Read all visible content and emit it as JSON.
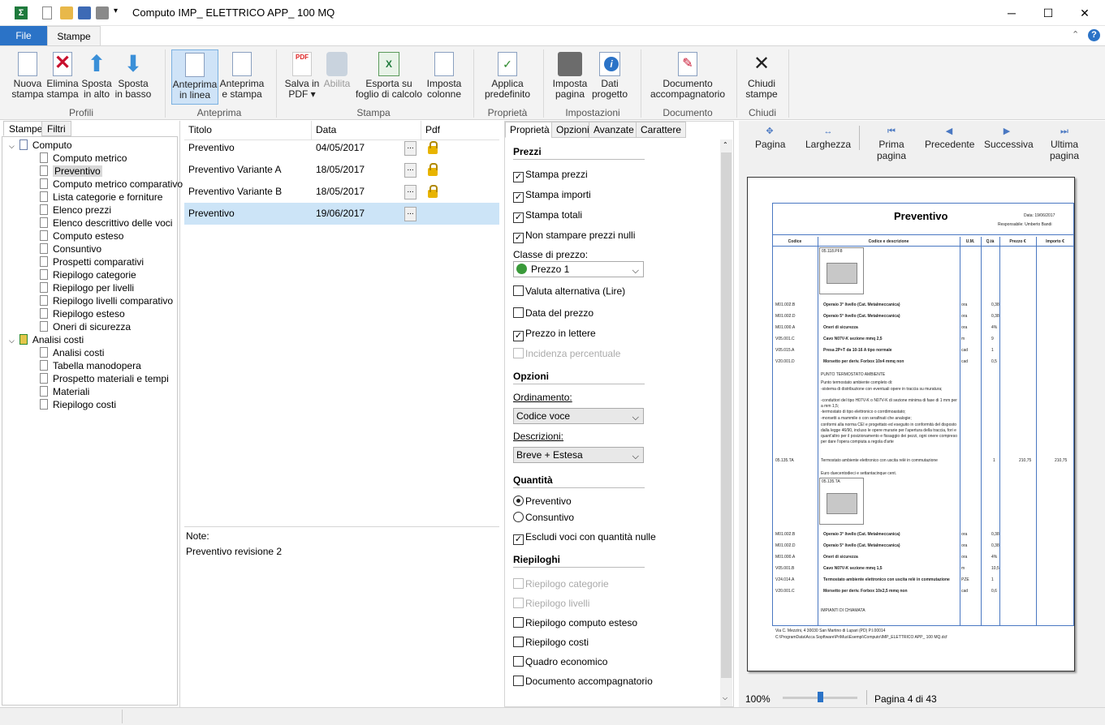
{
  "window": {
    "title": "Computo IMP_ ELETTRICO APP_ 100 MQ",
    "minimize": "─",
    "maximize": "☐",
    "close": "✕"
  },
  "ribbon_tabs": {
    "file": "File",
    "stampe": "Stampe"
  },
  "ribbon": {
    "buttons": [
      {
        "label1": "Nuova",
        "label2": "stampa"
      },
      {
        "label1": "Elimina",
        "label2": "stampa"
      },
      {
        "label1": "Sposta",
        "label2": "in alto"
      },
      {
        "label1": "Sposta",
        "label2": "in basso"
      },
      {
        "label1": "Anteprima",
        "label2": "in linea"
      },
      {
        "label1": "Anteprima",
        "label2": "e stampa"
      },
      {
        "label1": "Salva in",
        "label2": "PDF ▾"
      },
      {
        "label1": "Abilita",
        "label2": ""
      },
      {
        "label1": "Esporta su",
        "label2": "foglio di calcolo"
      },
      {
        "label1": "Imposta",
        "label2": "colonne"
      },
      {
        "label1": "Applica",
        "label2": "predefinito"
      },
      {
        "label1": "Imposta",
        "label2": "pagina"
      },
      {
        "label1": "Dati",
        "label2": "progetto"
      },
      {
        "label1": "Documento",
        "label2": "accompagnatorio"
      },
      {
        "label1": "Chiudi",
        "label2": "stampe"
      }
    ],
    "groups": [
      "Profili",
      "Anteprima",
      "Stampa",
      "Proprietà",
      "Impostazioni",
      "Documento",
      "Chiudi"
    ]
  },
  "left_tabs": [
    "Stampe",
    "Filtri"
  ],
  "tree": {
    "root1": "Computo",
    "items1": [
      "Computo metrico",
      "Preventivo",
      "Computo metrico comparativo",
      "Lista categorie e forniture",
      "Elenco prezzi",
      "Elenco descrittivo delle voci",
      "Computo esteso",
      "Consuntivo",
      "Prospetti comparativi",
      "Riepilogo categorie",
      "Riepilogo per livelli",
      "Riepilogo livelli comparativo",
      "Riepilogo esteso",
      "Oneri di sicurezza"
    ],
    "root2": "Analisi costi",
    "items2": [
      "Analisi costi",
      "Tabella manodopera",
      "Prospetto materiali e tempi",
      "Materiali",
      "Riepilogo costi"
    ]
  },
  "list": {
    "headers": [
      "Titolo",
      "Data",
      "Pdf"
    ],
    "rows": [
      {
        "title": "Preventivo",
        "date": "04/05/2017",
        "btn": "..."
      },
      {
        "title": "Preventivo Variante A",
        "date": "18/05/2017",
        "btn": "..."
      },
      {
        "title": "Preventivo Variante B",
        "date": "18/05/2017",
        "btn": "..."
      },
      {
        "title": "Preventivo",
        "date": "19/06/2017",
        "btn": "..."
      }
    ],
    "notes_label": "Note:",
    "notes_value": "Preventivo revisione 2"
  },
  "props": {
    "tabs": [
      "Proprietà",
      "Opzioni",
      "Avanzate",
      "Carattere"
    ],
    "sec_prezzi": "Prezzi",
    "stampa_prezzi": "Stampa prezzi",
    "stampa_importi": "Stampa importi",
    "stampa_totali": "Stampa totali",
    "non_stampare": "Non stampare prezzi nulli",
    "classe_label": "Classe di prezzo:",
    "classe_value": "Prezzo 1",
    "valuta": "Valuta alternativa (Lire)",
    "data_prezzo": "Data del prezzo",
    "prezzo_lettere": "Prezzo in lettere",
    "incidenza": "Incidenza percentuale",
    "sec_opzioni": "Opzioni",
    "ordinamento_label": "Ordinamento:",
    "ordinamento_value": "Codice voce",
    "descrizioni_label": "Descrizioni:",
    "descrizioni_value": "Breve + Estesa",
    "sec_quantita": "Quantità",
    "preventivo": "Preventivo",
    "consuntivo": "Consuntivo",
    "escludi": "Escludi voci con quantità nulle",
    "sec_riepiloghi": "Riepiloghi",
    "riep_categorie": "Riepilogo categorie",
    "riep_livelli": "Riepilogo livelli",
    "riep_computo": "Riepilogo computo esteso",
    "riep_costi": "Riepilogo costi",
    "quadro": "Quadro economico",
    "documento": "Documento accompagnatorio",
    "check_mark": "✓",
    "arrow": "⌵"
  },
  "preview": {
    "nav": [
      "Pagina",
      "Larghezza",
      "Prima pagina",
      "Precedente",
      "Successiva",
      "Ultima pagina"
    ],
    "zoom": "100%",
    "page_info": "Pagina 4 di 43",
    "doc": {
      "title": "Preventivo",
      "date": "Data: 19/06/2017",
      "resp": "Responsabile: Umberto Bandi",
      "cols": [
        "Codice",
        "Codice e descrizione",
        "U.M.",
        "Q.tà",
        "Prezzo €",
        "Importo €"
      ],
      "img1": "05.118.PF8",
      "rows1": [
        {
          "code": "M01.002.B",
          "desc": "Operaio 3° livello (Cat. Metalmeccanica)",
          "um": "ora",
          "q": "0,38"
        },
        {
          "code": "M01.002.D",
          "desc": "Operaio 5° livello (Cat. Metalmeccanica)",
          "um": "ora",
          "q": "0,38"
        },
        {
          "code": "M01.000.A",
          "desc": "Oneri di sicurezza",
          "um": "ora",
          "q": "4%"
        },
        {
          "code": "V05.001.C",
          "desc": "Cavo N07V-K sezione mmq 2,5",
          "um": "m",
          "q": "9"
        },
        {
          "code": "V05.015.A",
          "desc": "Presa 2P+T da 10-16 A tipo normale",
          "um": "cad",
          "q": "1"
        },
        {
          "code": "V20.001.D",
          "desc": "Morsetto per deriv. Forbox 10x4 mmq non",
          "um": "cad",
          "q": "0,5"
        }
      ],
      "para_title": "PUNTO TERMOSTATO AMBIENTE",
      "para": [
        "Punto termostato ambiente completo di:",
        "-sistema di distribuzione con eventuali opere in traccia su muratura;",
        "-conduttori del tipo H07V-K o N07V-K di sezione minima di fase di 1 mm per a mm 1,5;",
        "-termostato di tipo elettronico o corrdimoastato;",
        "-morsetti a mammile o con serafinati che analogie;",
        "conformi alla norma CEI e progettato ed eseguito in conformità del disposto dalla legge 46/90, incluso le opere murarie per l'apertura della traccia, fori e quant'altro per il posizionamento e fissaggio dei pezzi, ogni onere compreso per dare l'opera compiuta a regola d'arte"
      ],
      "main_code": "05.135.TA",
      "main_desc": "Termostato ambiente elettronico con uscita relè in commutazione",
      "main_desc2": "Euro duecentodieci e settantacinque cent.",
      "main_q": "1",
      "main_p": "210,75",
      "main_i": "210,75",
      "img2": "05.135.TA",
      "rows2": [
        {
          "code": "M01.002.B",
          "desc": "Operaio 3° livello (Cat. Metalmeccanica)",
          "um": "ora",
          "q": "0,38"
        },
        {
          "code": "M01.002.D",
          "desc": "Operaio 5° livello (Cat. Metalmeccanica)",
          "um": "ora",
          "q": "0,38"
        },
        {
          "code": "M01.000.A",
          "desc": "Oneri di sicurezza",
          "um": "ora",
          "q": "4%"
        },
        {
          "code": "V05.001.B",
          "desc": "Cavo N07V-K sezione mmq 1,5",
          "um": "m",
          "q": "10,5"
        },
        {
          "code": "V24.014.A",
          "desc": "Termostato ambiente elettronico con uscita relè in commutazione",
          "um": "PZE",
          "q": "1"
        },
        {
          "code": "V20.001.C",
          "desc": "Morsetto per deriv. Forbox 10x2,5 mmq non",
          "um": "cad",
          "q": "0,6"
        }
      ],
      "tail": "IMPIANTI DI CHIAMATA",
      "foot1": "Via C. Mezzini, 4 30030 San Martino di Lupari (PD) P.I.00014",
      "foot2": "C:\\ProgramData\\Acca Sopftware\\PriMus\\Esempi\\Computo\\IMP_ELETTRICO APP_ 100 MQ.dcf"
    }
  }
}
